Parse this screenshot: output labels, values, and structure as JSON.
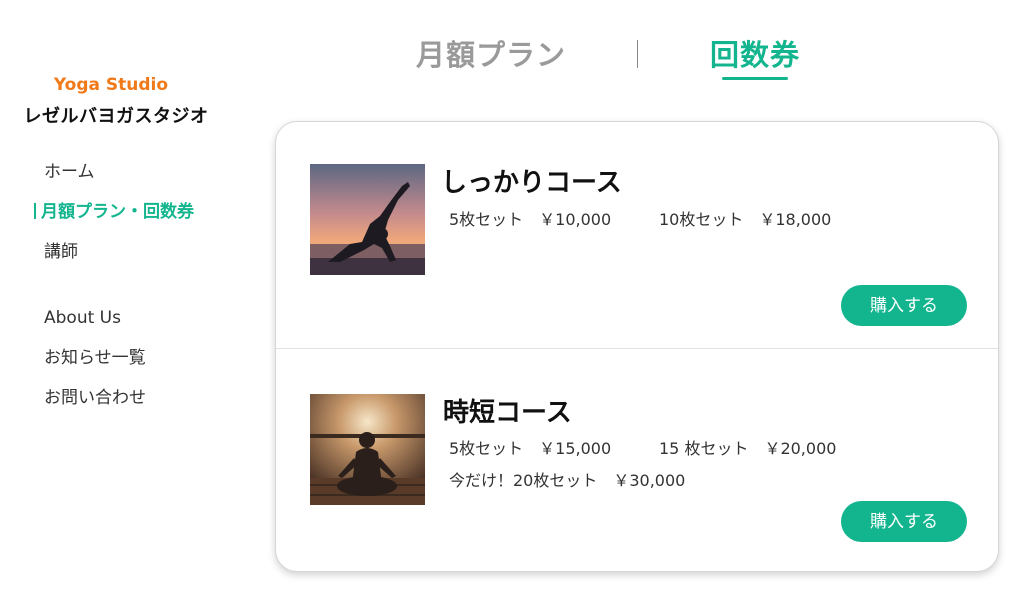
{
  "brand": {
    "name_en": "Yoga Studio",
    "name_jp": "レゼルバヨガスタジオ",
    "accent_color": "#f07a1a"
  },
  "nav": {
    "items": [
      {
        "label": "ホーム"
      },
      {
        "label": "月額プラン・回数券",
        "active": true
      },
      {
        "label": "講師"
      },
      {
        "label": "About Us"
      },
      {
        "label": "お知らせ一覧"
      },
      {
        "label": "お問い合わせ"
      }
    ]
  },
  "tabs": [
    {
      "label": "月額プラン",
      "active": false
    },
    {
      "label": "回数券",
      "active": true
    }
  ],
  "courses": [
    {
      "title": "しっかりコース",
      "image_icon": "yoga-sunset-pose-photo",
      "price_lines": [
        [
          "5枚セット　￥10,000",
          "10枚セット　￥18,000"
        ]
      ],
      "buy_label": "購入する"
    },
    {
      "title": "時短コース",
      "image_icon": "meditation-photo",
      "price_lines": [
        [
          "5枚セット　￥15,000",
          "15 枚セット　￥20,000"
        ],
        [
          "今だけ！20枚セット　￥30,000"
        ]
      ],
      "buy_label": "購入する"
    }
  ],
  "colors": {
    "primary": "#13b58e",
    "inactive_tab": "#9a9a9a"
  }
}
